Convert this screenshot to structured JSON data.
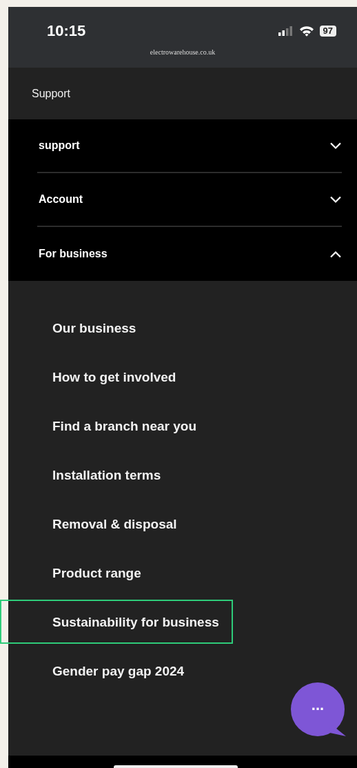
{
  "status_bar": {
    "time": "10:15",
    "battery": "97",
    "url": "electrowarehouse.co.uk"
  },
  "header": {
    "title": "Support"
  },
  "accordion": [
    {
      "label": "support",
      "expanded": false
    },
    {
      "label": "Account",
      "expanded": false
    },
    {
      "label": "For business",
      "expanded": true
    }
  ],
  "submenu": [
    {
      "label": "Our business",
      "highlighted": false
    },
    {
      "label": "How to get involved",
      "highlighted": false
    },
    {
      "label": "Find a branch near you",
      "highlighted": false
    },
    {
      "label": "Installation terms",
      "highlighted": false
    },
    {
      "label": "Removal & disposal",
      "highlighted": false
    },
    {
      "label": "Product range",
      "highlighted": false
    },
    {
      "label": "Sustainability for business",
      "highlighted": true
    },
    {
      "label": "Gender pay gap 2024",
      "highlighted": false
    }
  ],
  "chat_button": {
    "label": "..."
  }
}
